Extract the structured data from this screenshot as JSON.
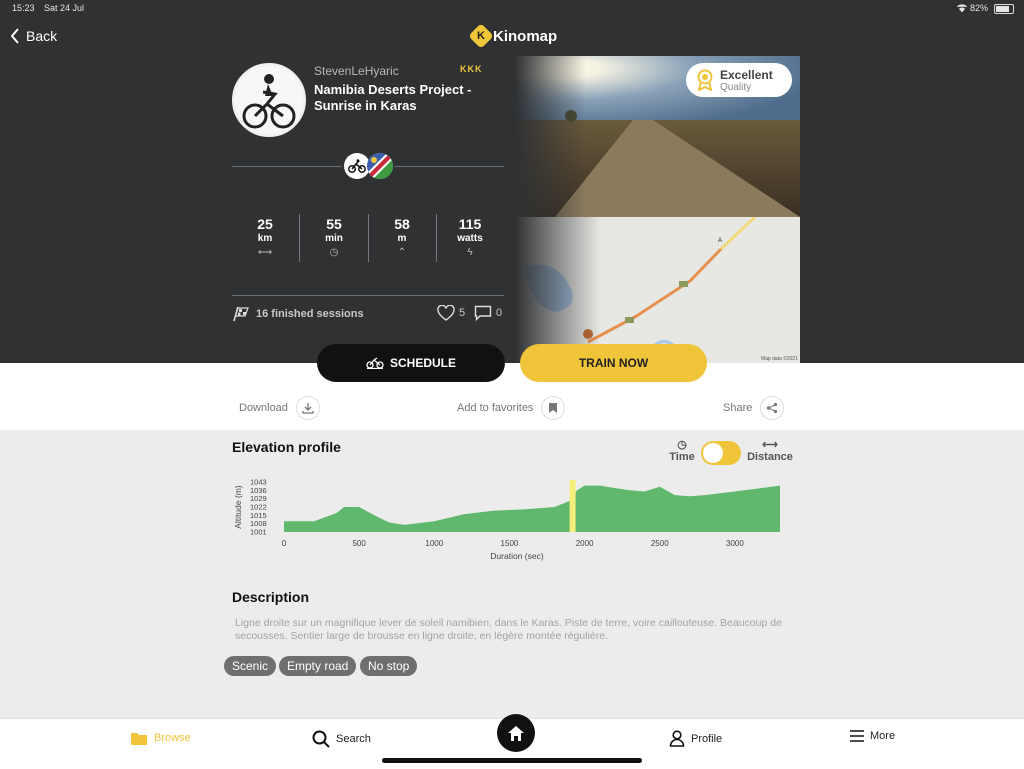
{
  "status_bar": {
    "time": "15:23",
    "date": "Sat 24 Jul",
    "battery": "82%"
  },
  "nav": {
    "back_label": "Back",
    "app_name": "Kinomap",
    "logo_letter": "K"
  },
  "route": {
    "author": "StevenLeHyaric",
    "badge": "KKK",
    "title": "Namibia Deserts Project - Sunrise in Karas",
    "quality_title": "Excellent",
    "quality_sub": "Quality",
    "map_credit": "Map data ©2021",
    "sessions": "16 finished sessions",
    "likes": "5",
    "comments": "0"
  },
  "stats": [
    {
      "value": "25",
      "unit": "km",
      "icon": "distance-icon"
    },
    {
      "value": "55",
      "unit": "min",
      "icon": "clock-icon"
    },
    {
      "value": "58",
      "unit": "m",
      "icon": "elevation-icon"
    },
    {
      "value": "115",
      "unit": "watts",
      "icon": "bolt-icon"
    }
  ],
  "actions": {
    "schedule": "SCHEDULE",
    "train_now": "TRAIN NOW"
  },
  "tools": {
    "download": "Download",
    "favorites": "Add to favorites",
    "share": "Share"
  },
  "elevation": {
    "title": "Elevation profile",
    "toggle_time": "Time",
    "toggle_distance": "Distance",
    "active": "Time"
  },
  "chart_data": {
    "type": "area",
    "xlabel": "Duration (sec)",
    "ylabel": "Altitude (m)",
    "xlim": [
      0,
      3300
    ],
    "ylim": [
      1001,
      1043
    ],
    "xticks": [
      "0",
      "500",
      "1000",
      "1500",
      "2000",
      "2500",
      "3000"
    ],
    "yticks": [
      "1043",
      "1036",
      "1029",
      "1022",
      "1015",
      "1008",
      "1001"
    ],
    "x": [
      0,
      200,
      350,
      400,
      500,
      600,
      700,
      800,
      1000,
      1200,
      1400,
      1600,
      1800,
      1900,
      1950,
      2000,
      2100,
      2200,
      2300,
      2400,
      2500,
      2600,
      2700,
      2800,
      3000,
      3300
    ],
    "y": [
      1010,
      1010,
      1017,
      1022,
      1022,
      1015,
      1009,
      1007,
      1010,
      1016,
      1019,
      1020,
      1022,
      1027,
      1036,
      1040,
      1040,
      1038,
      1036,
      1035,
      1039,
      1032,
      1031,
      1032,
      1035,
      1040
    ],
    "highlight": {
      "x": [
        1900,
        1940
      ],
      "color": "#f4ef7a"
    },
    "color": "#5fb86b"
  },
  "description": {
    "title": "Description",
    "text": "Ligne droite sur un magnifique lever de soleil namibien, dans le Karas. Piste de terre, voire caillouteuse. Beaucoup de secousses. Sentier large de brousse en ligne droite, en légère montée régulière."
  },
  "tags": [
    "Scenic",
    "Empty road",
    "No stop"
  ],
  "tabs": {
    "browse": "Browse",
    "search": "Search",
    "profile": "Profile",
    "more": "More"
  },
  "colors": {
    "accent": "#f0c53a",
    "dark": "#2f3133",
    "chart_green": "#5fb86b"
  }
}
